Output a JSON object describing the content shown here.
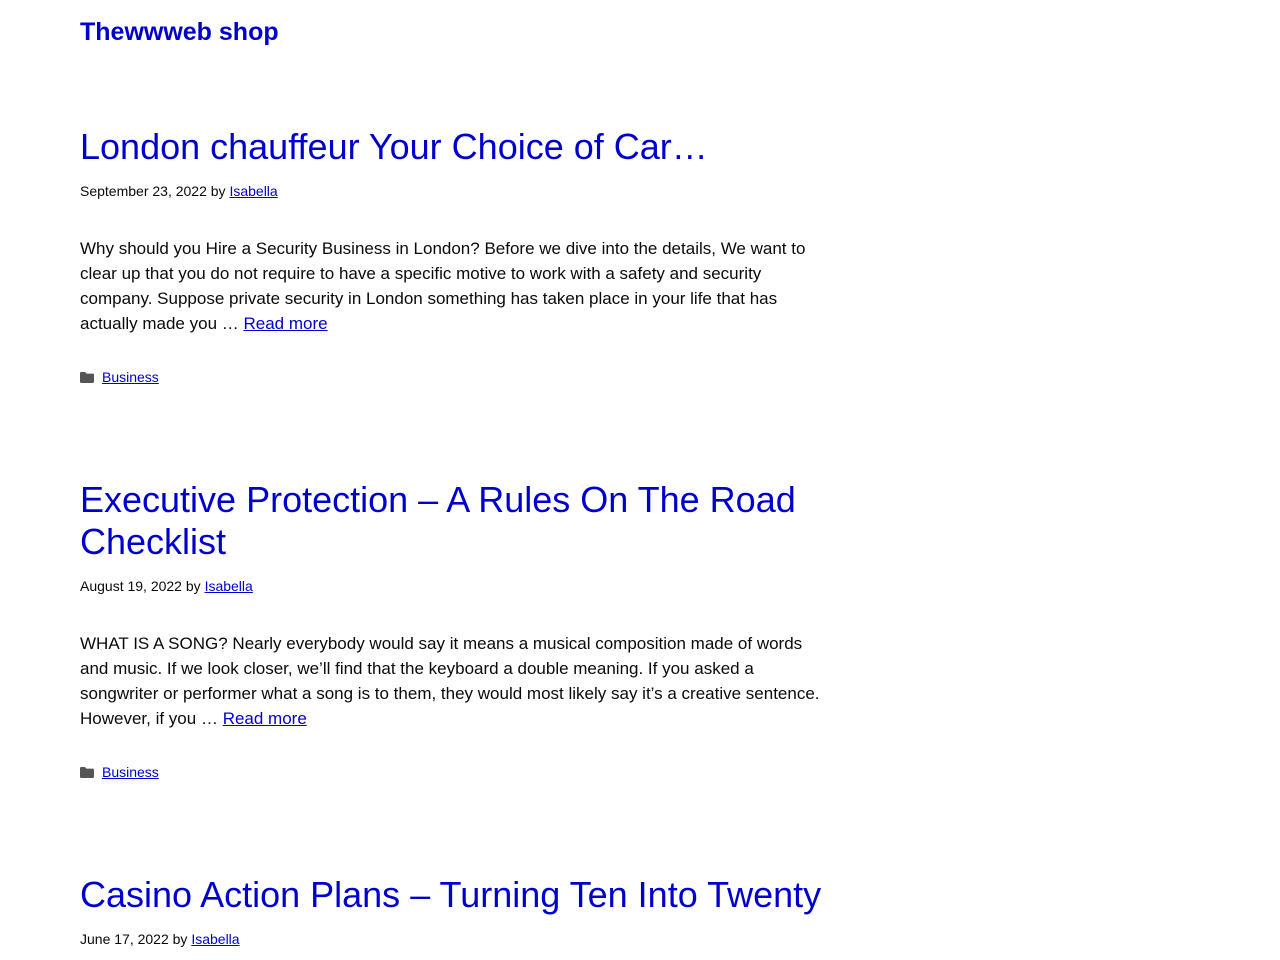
{
  "site": {
    "title": "Thewwweb shop"
  },
  "colors": {
    "link": "#0000cc",
    "text": "#0a0a0a",
    "icon": "#555555"
  },
  "posts": [
    {
      "title": "London chauffeur Your Choice of Car…",
      "date": "September 23, 2022",
      "by": "by",
      "author": "Isabella",
      "excerpt": "Why should you Hire a Security Business in London? Before we dive into the details, We want to clear up that you do not require to have a specific motive to work with a safety and security company. Suppose private security in London something has taken place in your life that has actually made you …",
      "read_more": "Read more",
      "category_icon": "folder-icon",
      "category": "Business"
    },
    {
      "title": "Executive Protection – A Rules On The Road Checklist",
      "date": "August 19, 2022",
      "by": "by",
      "author": "Isabella",
      "excerpt": "WHAT IS A SONG? Nearly everybody would say it means a musical composition made of words and music. If we look closer, we’ll find that the keyboard a double meaning. If you asked a songwriter or performer what a song is to them, they would most likely say it’s a creative sentence. However, if you …",
      "read_more": "Read more",
      "category_icon": "folder-icon",
      "category": "Business"
    },
    {
      "title": "Casino Action Plans – Turning Ten Into Twenty",
      "date": "June 17, 2022",
      "by": "by",
      "author": "Isabella"
    }
  ]
}
